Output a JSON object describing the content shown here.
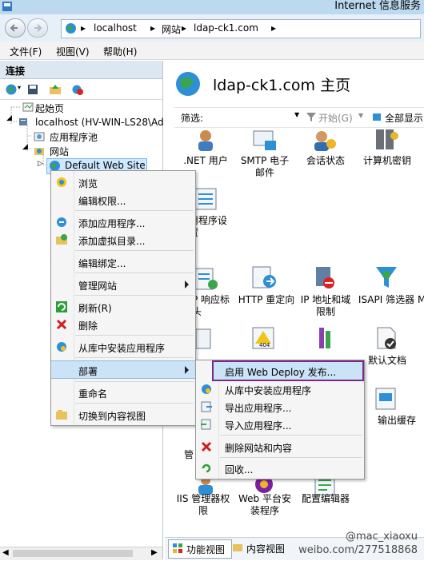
{
  "window": {
    "title": "Internet 信息服务"
  },
  "address": {
    "segments": [
      "localhost",
      "网站",
      "ldap-ck1.com"
    ]
  },
  "menubar": {
    "items": [
      "文件(F)",
      "视图(V)",
      "帮助(H)"
    ]
  },
  "connections": {
    "header": "连接",
    "tree": {
      "start_page": "起始页",
      "server": "localhost (HV-WIN-LS28\\Ad",
      "app_pools": "应用程序池",
      "sites": "网站",
      "default_site": "Default Web Site"
    }
  },
  "main": {
    "title": "ldap-ck1.com 主页",
    "filter_label": "筛选:",
    "start_label": "开始(G)",
    "show_all_label": "全部显示",
    "features": [
      {
        "line1": ".NET 用户",
        "line2": ""
      },
      {
        "line1": "SMTP 电子",
        "line2": "邮件"
      },
      {
        "line1": "会话状态",
        "line2": ""
      },
      {
        "line1": "计算机密钥",
        "line2": ""
      },
      {
        "line1": "用程序设",
        "line2": "置"
      },
      {
        "line1": "P 响应标",
        "line2": "头"
      },
      {
        "line1": "HTTP 重定向",
        "line2": ""
      },
      {
        "line1": "IP 地址和域",
        "line2": "限制"
      },
      {
        "line1": "ISAPI 筛选器",
        "line2": ""
      },
      {
        "line1": "M",
        "line2": ""
      },
      {
        "line1": "默认文档",
        "line2": ""
      },
      {
        "line1": "输出缓存",
        "line2": ""
      },
      {
        "line1": "IIS 管理器权",
        "line2": "限"
      },
      {
        "line1": "Web 平台安",
        "line2": "装程序"
      },
      {
        "line1": "配置编辑器",
        "line2": ""
      },
      {
        "line1": "管",
        "line2": ""
      }
    ],
    "view_tabs": [
      "功能视图",
      "内容视图"
    ]
  },
  "context_menu": {
    "items": [
      "浏览",
      "编辑权限...",
      "添加应用程序...",
      "添加虚拟目录...",
      "编辑绑定...",
      "管理网站",
      "刷新(R)",
      "删除",
      "从库中安装应用程序",
      "部署",
      "重命名",
      "切换到内容视图"
    ]
  },
  "submenu": {
    "items": [
      "启用 Web Deploy 发布...",
      "从库中安装应用程序",
      "导出应用程序...",
      "导入应用程序...",
      "删除网站和内容",
      "回收..."
    ]
  },
  "watermark": {
    "line1": "@mac_xiaoxu",
    "line2": "weibo.com/277518868"
  }
}
